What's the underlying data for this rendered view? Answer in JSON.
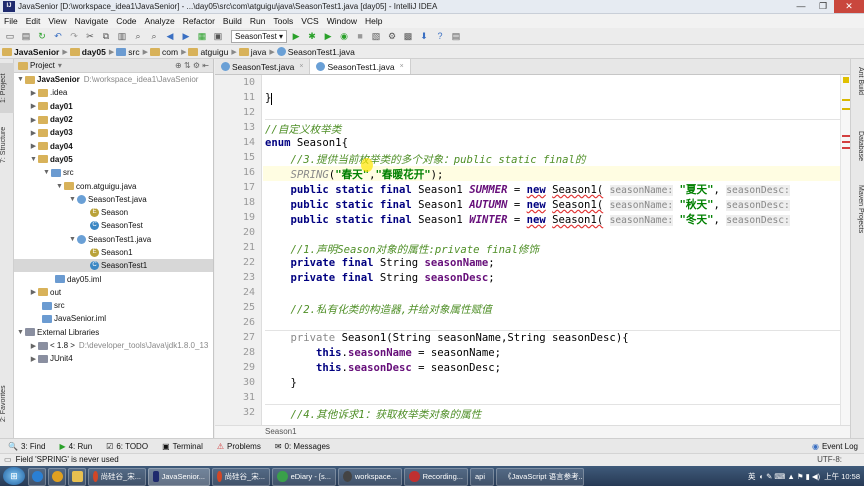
{
  "window": {
    "title": "JavaSenior [D:\\workspace_idea1\\JavaSenior] - ...\\day05\\src\\com\\atguigu\\java\\SeasonTest1.java [day05] - IntelliJ IDEA",
    "app_icon_label": "IJ",
    "controls": [
      "—",
      "❐",
      "✕"
    ]
  },
  "menu": [
    "File",
    "Edit",
    "View",
    "Navigate",
    "Code",
    "Analyze",
    "Refactor",
    "Build",
    "Run",
    "Tools",
    "VCS",
    "Window",
    "Help"
  ],
  "toolbar": {
    "run_config": "SeasonTest"
  },
  "breadcrumbs": [
    "JavaSenior",
    "day05",
    "src",
    "com",
    "atguigu",
    "java",
    "SeasonTest1.java"
  ],
  "left_strip": {
    "project": "1: Project",
    "structure": "7: Structure",
    "favorites": "2: Favorites"
  },
  "right_strip": {
    "ant": "Ant Build",
    "database": "Database",
    "maven": "Maven Projects"
  },
  "project_panel": {
    "title": "Project",
    "tree": [
      {
        "label": "JavaSenior",
        "path": "D:\\workspace_idea1\\JavaSenior",
        "bold": true
      },
      {
        "label": ".idea"
      },
      {
        "label": "day01",
        "bold": true
      },
      {
        "label": "day02",
        "bold": true
      },
      {
        "label": "day03",
        "bold": true
      },
      {
        "label": "day04",
        "bold": true
      },
      {
        "label": "day05",
        "bold": true
      },
      {
        "label": "src"
      },
      {
        "label": "com.atguigu.java"
      },
      {
        "label": "SeasonTest.java"
      },
      {
        "label": "Season"
      },
      {
        "label": "SeasonTest"
      },
      {
        "label": "SeasonTest1.java"
      },
      {
        "label": "Season1"
      },
      {
        "label": "SeasonTest1"
      },
      {
        "label": "day05.iml"
      },
      {
        "label": "out"
      },
      {
        "label": "src"
      },
      {
        "label": "JavaSenior.iml"
      },
      {
        "label": "External Libraries"
      },
      {
        "label": "< 1.8 >",
        "path": "D:\\developer_tools\\Java\\jdk1.8.0_13"
      },
      {
        "label": "JUnit4"
      }
    ]
  },
  "tabs": [
    {
      "label": "SeasonTest.java",
      "close": "×"
    },
    {
      "label": "SeasonTest1.java",
      "close": "×"
    }
  ],
  "editor": {
    "line_numbers": [
      "10",
      "11",
      "12",
      "13",
      "14",
      "15",
      "16",
      "17",
      "18",
      "19",
      "20",
      "21",
      "22",
      "23",
      "24",
      "25",
      "26",
      "27",
      "28",
      "29",
      "30",
      "31",
      "32"
    ],
    "tokens": {
      "close_brace": "}",
      "comment_enum": "//自定义枚举类",
      "kw_enum": "enum",
      "enum_name": "Season1",
      "open_brace": "{",
      "comment_objects": "//3.提供当前枚举类的多个对象：public static final的",
      "spring": "SPRING",
      "paren_open": "(",
      "spring_arg1": "\"春天\"",
      "comma": ",",
      "spring_arg2": "\"春暖花开\"",
      "paren_close_semi": ");",
      "public": "public",
      "static": "static",
      "final": "final",
      "type_season1": "Season1",
      "summer": "SUMMER",
      "autumn": "AUTUMN",
      "winter": "WINTER",
      "eq": "=",
      "new": "new",
      "ctor_call": "Season1(",
      "hint_name": "seasonName:",
      "hint_desc": "seasonDesc:",
      "summer_arg": "\"夏天\"",
      "autumn_arg": "\"秋天\"",
      "winter_arg": "\"冬天\"",
      "comment_fields": "//1.声明Season对象的属性:private final修饰",
      "private": "private",
      "string": "String",
      "season_name": "seasonName",
      "season_desc": "seasonDesc",
      "semi": ";",
      "comment_ctor": "//2.私有化类的构造器,并给对象属性赋值",
      "ctor_sig": "Season1(String seasonName,String seasonDesc){",
      "this": "this",
      "dot": ".",
      "assign_name": " = seasonName;",
      "assign_desc": " = seasonDesc;",
      "comment_other": "//4.其他诉求1：获取枚举类对象的属性"
    }
  },
  "editor_breadcrumb": "Season1",
  "bottom_tools": [
    {
      "icon": "🔍",
      "label": "3: Find"
    },
    {
      "icon": "▶",
      "label": "4: Run"
    },
    {
      "icon": "☑",
      "label": "6: TODO"
    },
    {
      "icon": "▣",
      "label": "Terminal"
    },
    {
      "icon": "⚠",
      "label": "Problems"
    },
    {
      "icon": "✉",
      "label": "0: Messages"
    }
  ],
  "event_log": "Event Log",
  "status": {
    "message": "Field 'SPRING' is never used",
    "encoding": "UTF-8:"
  },
  "taskbar": {
    "start": "⊞",
    "items": [
      "尚硅谷_宋...",
      "JavaSenior...",
      "尚硅谷_宋...",
      "eDiary - [s...",
      "workspace...",
      "Recording...",
      "《JavaScript 语言参考..."
    ],
    "app": "api",
    "tray": {
      "ime": "英",
      "time": "上午 10:58"
    },
    "colors": {
      "ie": "#2a7fd4",
      "chrome": "#e0a020",
      "explorer": "#e8c050",
      "idea": "#1e2a6e",
      "ppt": "#d24726",
      "ediary": "#3aa04a",
      "obs": "#444444",
      "recording": "#c03030",
      "js": "#2a5fa0"
    }
  }
}
